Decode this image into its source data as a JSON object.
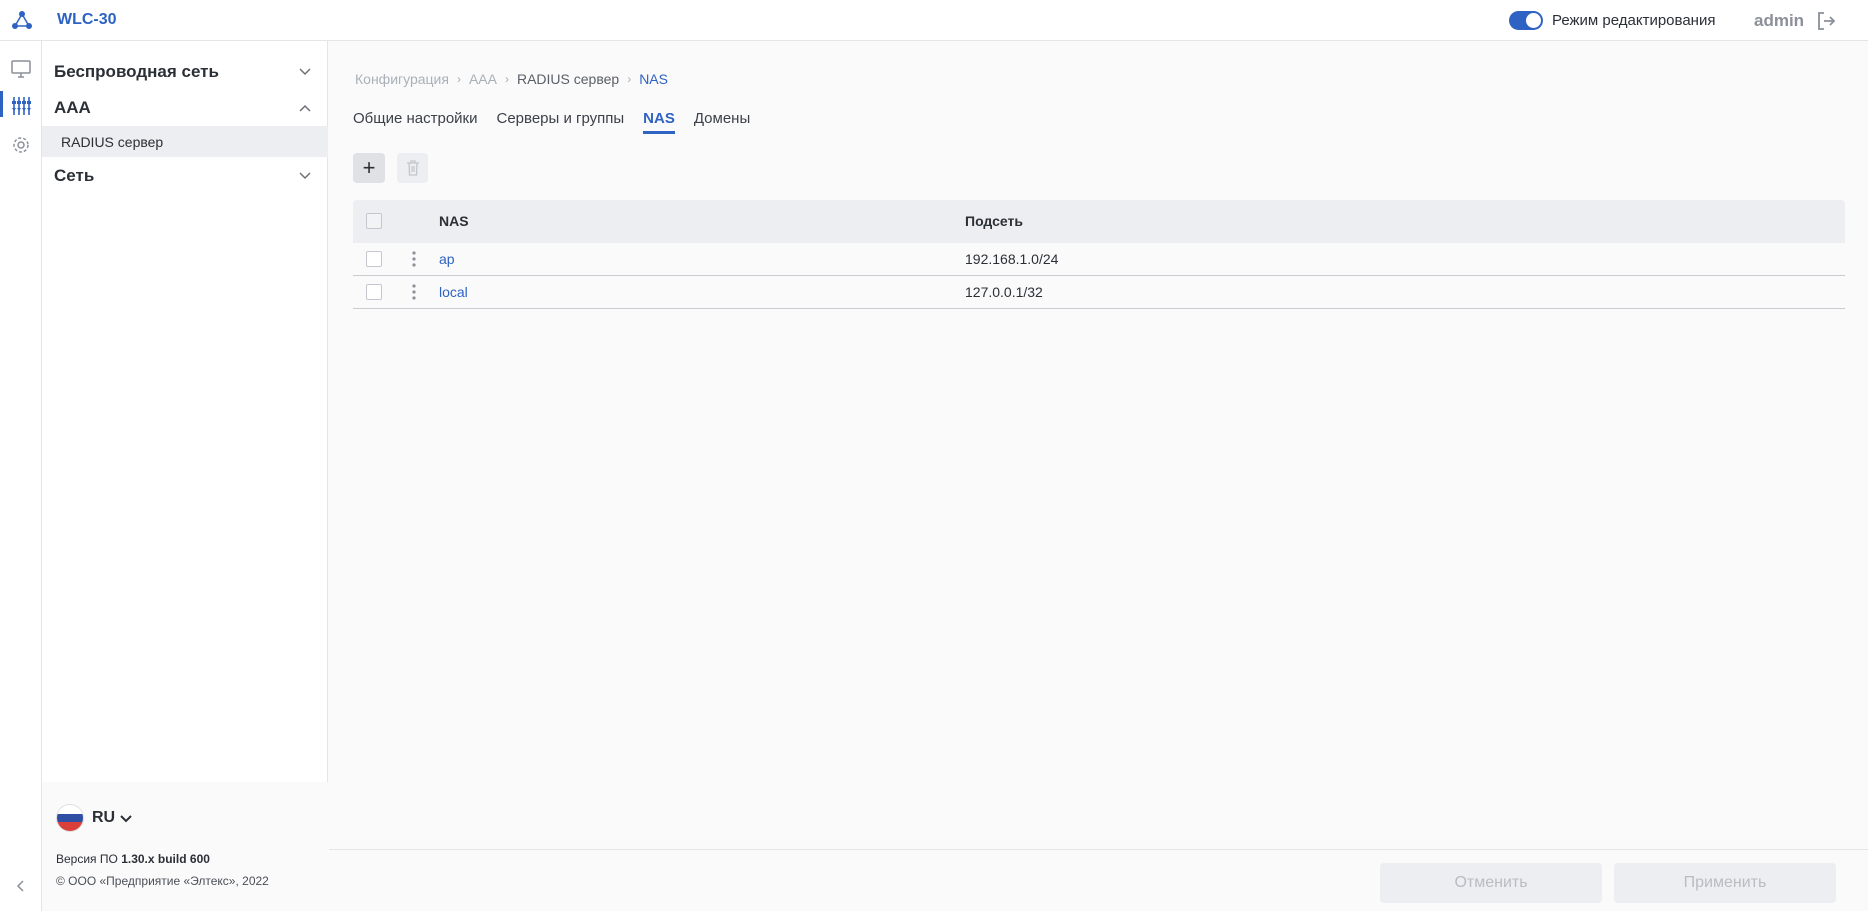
{
  "header": {
    "app_title": "WLC-30",
    "edit_mode_label": "Режим редактирования",
    "user": "admin"
  },
  "colors": {
    "accent": "#2e62c3"
  },
  "rail": {
    "icons": [
      "monitor-icon",
      "config-sliders-icon",
      "gear-icon"
    ]
  },
  "sidebar": {
    "groups": [
      {
        "label": "Беспроводная сеть",
        "expanded": false
      },
      {
        "label": "AAA",
        "expanded": true,
        "items": [
          {
            "label": "RADIUS сервер",
            "selected": true
          }
        ]
      },
      {
        "label": "Сеть",
        "expanded": false
      }
    ],
    "footer": {
      "lang": "RU",
      "version_prefix": "Версия ПО",
      "version": "1.30.x build 600",
      "copyright": "© ООО «Предприятие «Элтекс», 2022"
    }
  },
  "breadcrumb": [
    "Конфигурация",
    "AAA",
    "RADIUS сервер",
    "NAS"
  ],
  "tabs": [
    {
      "label": "Общие настройки"
    },
    {
      "label": "Серверы и группы"
    },
    {
      "label": "NAS",
      "active": true
    },
    {
      "label": "Домены"
    }
  ],
  "table": {
    "columns": [
      "NAS",
      "Подсеть"
    ],
    "rows": [
      {
        "nas": "ap",
        "subnet": "192.168.1.0/24"
      },
      {
        "nas": "local",
        "subnet": "127.0.0.1/32"
      }
    ]
  },
  "footer_buttons": {
    "cancel": "Отменить",
    "apply": "Применить"
  }
}
